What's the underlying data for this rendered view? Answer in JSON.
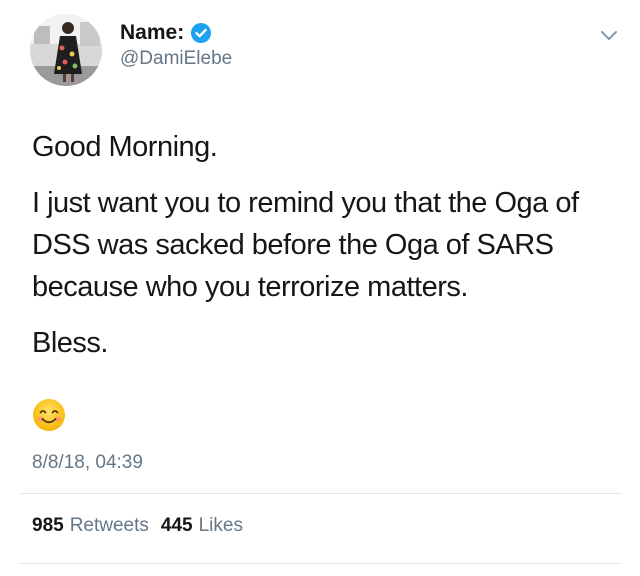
{
  "author": {
    "display_name": "Name:",
    "handle": "@DamiElebe",
    "verified": true,
    "avatar_icon": "profile-photo"
  },
  "tweet": {
    "paragraphs": [
      "Good Morning.",
      "I just want you to remind you that the Oga of DSS was sacked before the Oga of SARS because who you terrorize matters.",
      "Bless."
    ],
    "emoji": "smiling-face-icon",
    "timestamp": "8/8/18, 04:39"
  },
  "stats": {
    "retweets_count": "985",
    "retweets_label": "Retweets",
    "likes_count": "445",
    "likes_label": "Likes"
  },
  "colors": {
    "text": "#14171a",
    "secondary": "#657786",
    "verified": "#1da1f2",
    "divider": "#e1e8ed"
  }
}
